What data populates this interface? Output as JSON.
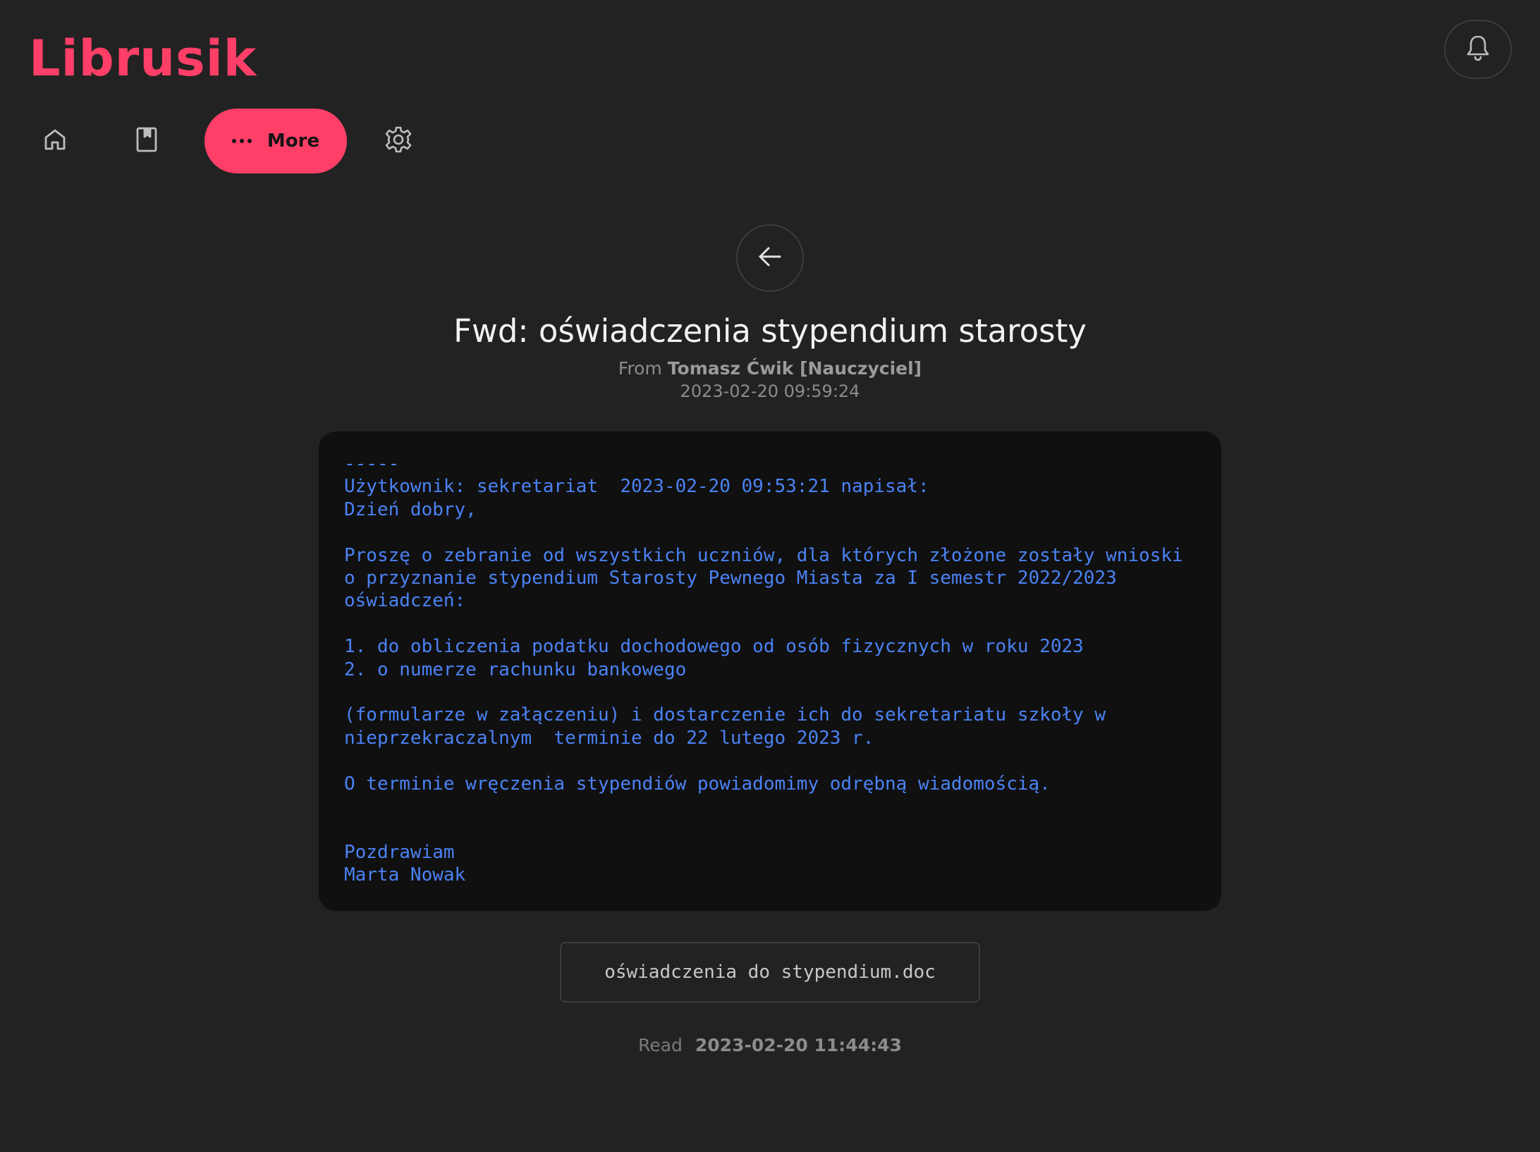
{
  "app": {
    "brand": "Librusik"
  },
  "nav": {
    "home_icon": "home-icon",
    "book_icon": "book-icon",
    "more_label": "More",
    "more_icon": "more-dots-icon",
    "settings_icon": "gear-icon",
    "bell_icon": "bell-icon"
  },
  "message": {
    "back_icon": "arrow-left-icon",
    "title": "Fwd: oświadczenia stypendium starosty",
    "from_prefix": "From",
    "sender": "Tomasz Ćwik [Nauczyciel]",
    "date": "2023-02-20 09:59:24",
    "body": "-----\nUżytkownik: sekretariat  2023-02-20 09:53:21 napisał:\nDzień dobry,\n\nProszę o zebranie od wszystkich uczniów, dla których złożone zostały wnioski\no przyznanie stypendium Starosty Pewnego Miasta za I semestr 2022/2023\noświadczeń:\n\n1. do obliczenia podatku dochodowego od osób fizycznych w roku 2023\n2. o numerze rachunku bankowego\n\n(formularze w załączeniu) i dostarczenie ich do sekretariatu szkoły w\nnieprzekraczalnym  terminie do 22 lutego 2023 r.\n\nO terminie wręczenia stypendiów powiadomimy odrębną wiadomością.\n\n\nPozdrawiam\nMarta Nowak",
    "attachment": "oświadczenia do stypendium.doc",
    "read_label": "Read",
    "read_time": "2023-02-20 11:44:43"
  },
  "colors": {
    "background": "#222222",
    "accent": "#ff3f68",
    "body_bg": "#101010",
    "body_text": "#4b82f4"
  }
}
